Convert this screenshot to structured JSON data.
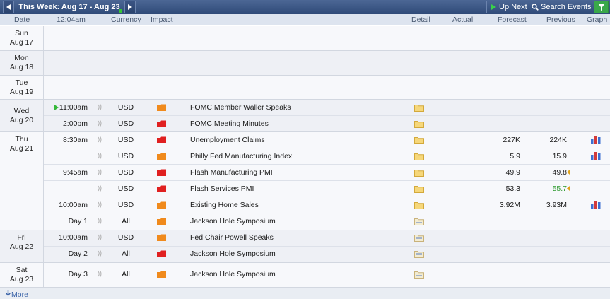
{
  "topbar": {
    "week_title": "This Week: Aug 17 - Aug 23",
    "up_next": "Up Next",
    "search_events": "Search Events"
  },
  "columns": {
    "date": "Date",
    "time": "12:04am",
    "currency": "Currency",
    "impact": "Impact",
    "detail": "Detail",
    "actual": "Actual",
    "forecast": "Forecast",
    "previous": "Previous",
    "graph": "Graph"
  },
  "days": [
    {
      "dow": "Sun",
      "date": "Aug 17"
    },
    {
      "dow": "Mon",
      "date": "Aug 18"
    },
    {
      "dow": "Tue",
      "date": "Aug 19"
    },
    {
      "dow": "Wed",
      "date": "Aug 20"
    },
    {
      "dow": "Thu",
      "date": "Aug 21"
    },
    {
      "dow": "Fri",
      "date": "Aug 22"
    },
    {
      "dow": "Sat",
      "date": "Aug 23"
    }
  ],
  "events": [
    {
      "time": "11:00am",
      "currency": "USD",
      "impact": "orange",
      "title": "FOMC Member Waller Speaks",
      "forecast": "",
      "previous": ""
    },
    {
      "time": "2:00pm",
      "currency": "USD",
      "impact": "red",
      "title": "FOMC Meeting Minutes",
      "forecast": "",
      "previous": ""
    },
    {
      "time": "8:30am",
      "currency": "USD",
      "impact": "red",
      "title": "Unemployment Claims",
      "forecast": "227K",
      "previous": "224K"
    },
    {
      "time": "",
      "currency": "USD",
      "impact": "orange",
      "title": "Philly Fed Manufacturing Index",
      "forecast": "5.9",
      "previous": "15.9"
    },
    {
      "time": "9:45am",
      "currency": "USD",
      "impact": "red",
      "title": "Flash Manufacturing PMI",
      "forecast": "49.9",
      "previous": "49.8"
    },
    {
      "time": "",
      "currency": "USD",
      "impact": "red",
      "title": "Flash Services PMI",
      "forecast": "53.3",
      "previous": "55.7"
    },
    {
      "time": "10:00am",
      "currency": "USD",
      "impact": "orange",
      "title": "Existing Home Sales",
      "forecast": "3.92M",
      "previous": "3.93M"
    },
    {
      "time": "Day 1",
      "currency": "All",
      "impact": "orange",
      "title": "Jackson Hole Symposium",
      "forecast": "",
      "previous": ""
    },
    {
      "time": "10:00am",
      "currency": "USD",
      "impact": "orange",
      "title": "Fed Chair Powell Speaks",
      "forecast": "",
      "previous": ""
    },
    {
      "time": "Day 2",
      "currency": "All",
      "impact": "red",
      "title": "Jackson Hole Symposium",
      "forecast": "",
      "previous": ""
    },
    {
      "time": "Day 3",
      "currency": "All",
      "impact": "orange",
      "title": "Jackson Hole Symposium",
      "forecast": "",
      "previous": ""
    }
  ],
  "footer": {
    "more": "More"
  },
  "colors": {
    "impact_red": "#e02020",
    "impact_orange": "#f08a1c",
    "previous_better": "#2f9a2f",
    "header_bar": "#3b5584",
    "filter_green": "#3aa84a"
  },
  "icons": {
    "prev_week": "triangle-left-icon",
    "next_week": "triangle-right-icon",
    "up_next": "play-icon",
    "search": "magnifier-icon",
    "filter": "funnel-icon",
    "sound": "speaker-icon",
    "detail": "folder-icon",
    "graph": "bar-chart-icon",
    "more": "arrow-down-icon"
  }
}
